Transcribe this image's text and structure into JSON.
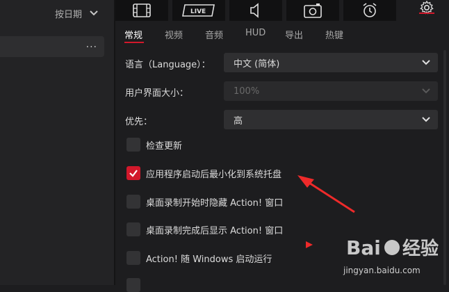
{
  "sidebar": {
    "sort_label": "按日期",
    "more_label": "..."
  },
  "toolbar": {
    "buttons": [
      {
        "name": "video-library",
        "icon": "film-icon"
      },
      {
        "name": "live",
        "icon": "live-icon",
        "text": "LIVE"
      },
      {
        "name": "audio",
        "icon": "speaker-icon"
      },
      {
        "name": "screenshot",
        "icon": "camera-icon"
      },
      {
        "name": "alarm",
        "icon": "alarm-icon"
      },
      {
        "name": "settings",
        "icon": "gear-icon",
        "active": true
      }
    ]
  },
  "tabs": [
    {
      "label": "常规",
      "active": true
    },
    {
      "label": "视频"
    },
    {
      "label": "音频"
    },
    {
      "label": "HUD"
    },
    {
      "label": "导出"
    },
    {
      "label": "热键"
    }
  ],
  "settings": {
    "language": {
      "label": "语言（Language）：",
      "value": "中文 (简体)"
    },
    "ui_size": {
      "label": "用户界面大小：",
      "value": "100%",
      "disabled": true
    },
    "priority": {
      "label": "优先：",
      "value": "高"
    }
  },
  "checkboxes": [
    {
      "label": "检查更新",
      "checked": false
    },
    {
      "label": "应用程序启动后最小化到系统托盘",
      "checked": true
    },
    {
      "label": "桌面录制开始时隐藏 Action! 窗口",
      "checked": false
    },
    {
      "label": "桌面录制完成后显示 Action! 窗口",
      "checked": false
    },
    {
      "label": "Action! 随 Windows 启动运行",
      "checked": false
    }
  ],
  "watermark": {
    "url": "jingyan.baidu.com"
  },
  "colors": {
    "accent": "#d2182b",
    "background": "#1d1d1f",
    "panel": "#2f2f31"
  }
}
